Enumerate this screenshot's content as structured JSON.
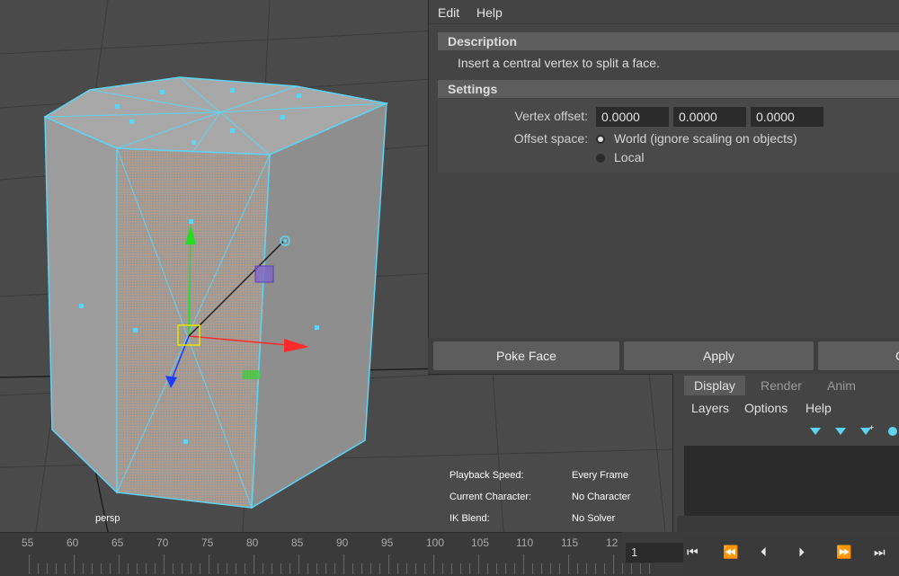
{
  "window": {
    "menu": [
      "Edit",
      "Help"
    ]
  },
  "dialog": {
    "description_header": "Description",
    "description_text": "Insert a central vertex to split a face.",
    "settings_header": "Settings",
    "vertex_offset_label": "Vertex offset:",
    "vertex_offset": [
      "0.0000",
      "0.0000",
      "0.0000"
    ],
    "offset_space_label": "Offset space:",
    "offset_space_options": [
      {
        "label": "World (ignore scaling on objects)",
        "selected": true
      },
      {
        "label": "Local",
        "selected": false
      }
    ],
    "buttons": {
      "poke": "Poke Face",
      "apply": "Apply",
      "close": "C"
    }
  },
  "viewport": {
    "camera": "persp",
    "hud": [
      {
        "label": "Playback Speed:",
        "value": "Every Frame"
      },
      {
        "label": "Current Character:",
        "value": "No Character"
      },
      {
        "label": "IK Blend:",
        "value": "No Solver"
      }
    ],
    "colors": {
      "selection": "#5fd3f3",
      "face_highlight": "#c79a7b",
      "x_axis": "#ff2a2a",
      "y_axis": "#22dd22",
      "z_axis": "#1d3cff"
    }
  },
  "layer_editor": {
    "tabs": [
      {
        "label": "Display",
        "active": true
      },
      {
        "label": "Render",
        "active": false
      },
      {
        "label": "Anim",
        "active": false
      }
    ],
    "menu": [
      "Layers",
      "Options",
      "Help"
    ]
  },
  "timeline": {
    "ticks": [
      "55",
      "60",
      "65",
      "70",
      "75",
      "80",
      "85",
      "90",
      "95",
      "100",
      "105",
      "110",
      "115",
      "12"
    ],
    "current_frame": "1"
  }
}
